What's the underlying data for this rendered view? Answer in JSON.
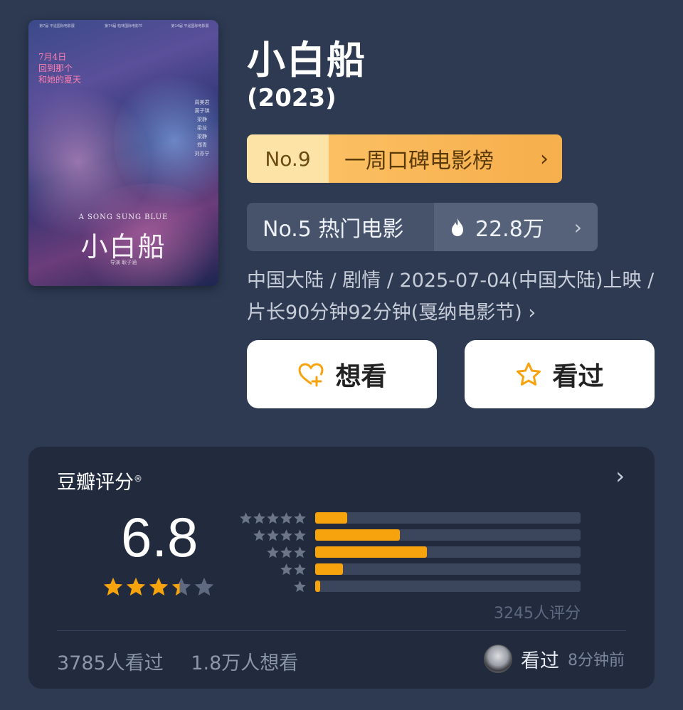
{
  "poster": {
    "awards": [
      "第7届 平遥国际电影展",
      "第74届 柏林国际电影节",
      "第14届 平遥国际电影展"
    ],
    "date_line1": "7月4日",
    "date_line2": "回到那个",
    "date_line3": "和她的夏天",
    "cast": [
      "周美君",
      "黄子琪",
      "梁静",
      "梁龙",
      "梁静",
      "郑青",
      "刘亦宁"
    ],
    "title_en": "A SONG SUNG BLUE",
    "title_cn": "小白船",
    "director": "导演 耿子涵"
  },
  "movie": {
    "title": "小白船",
    "year": "(2023)"
  },
  "rank_week": {
    "no": "No.9",
    "label": "一周口碑电影榜",
    "chev": "›"
  },
  "rank_hot": {
    "label": "No.5 热门电影",
    "heat": "22.8万",
    "chev": "›"
  },
  "meta": {
    "line": "中国大陆 / 剧情 / 2025-07-04(中国大陆)上映 / 片长90分钟92分钟(戛纳电影节) ›"
  },
  "buttons": {
    "want": "想看",
    "seen": "看过"
  },
  "rating": {
    "heading": "豆瓣评分",
    "reg": "®",
    "score": "6.8",
    "stars_value": 3.4,
    "distribution": [
      {
        "stars": 5,
        "fraction": 0.12
      },
      {
        "stars": 4,
        "fraction": 0.32
      },
      {
        "stars": 3,
        "fraction": 0.42
      },
      {
        "stars": 2,
        "fraction": 0.105
      },
      {
        "stars": 1,
        "fraction": 0.02
      }
    ],
    "count": "3245人评分",
    "seen_count": "3785人看过",
    "want_count": "1.8万人想看",
    "recent_action": "看过",
    "recent_time": "8分钟前"
  },
  "colors": {
    "background": "#2d3a52",
    "accent": "#f7a30e",
    "card": "#222b3e"
  }
}
